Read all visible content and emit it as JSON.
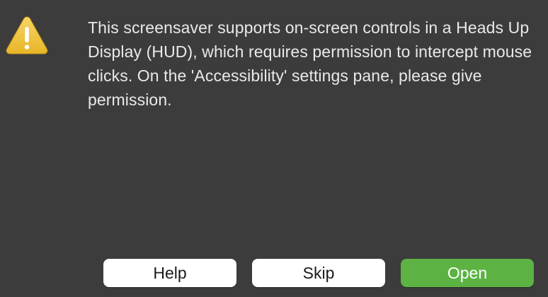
{
  "dialog": {
    "icon": "warning-triangle-icon",
    "message": "This screensaver supports on-screen controls in a Heads Up Display (HUD), which requires permission to intercept mouse clicks. On the 'Accessibility' settings pane, please give permission."
  },
  "buttons": {
    "help_label": "Help",
    "skip_label": "Skip",
    "open_label": "Open"
  },
  "colors": {
    "background": "#3c3c3c",
    "primary_button": "#5cb343",
    "secondary_button": "#ffffff",
    "warning_icon": "#f2c23a"
  }
}
